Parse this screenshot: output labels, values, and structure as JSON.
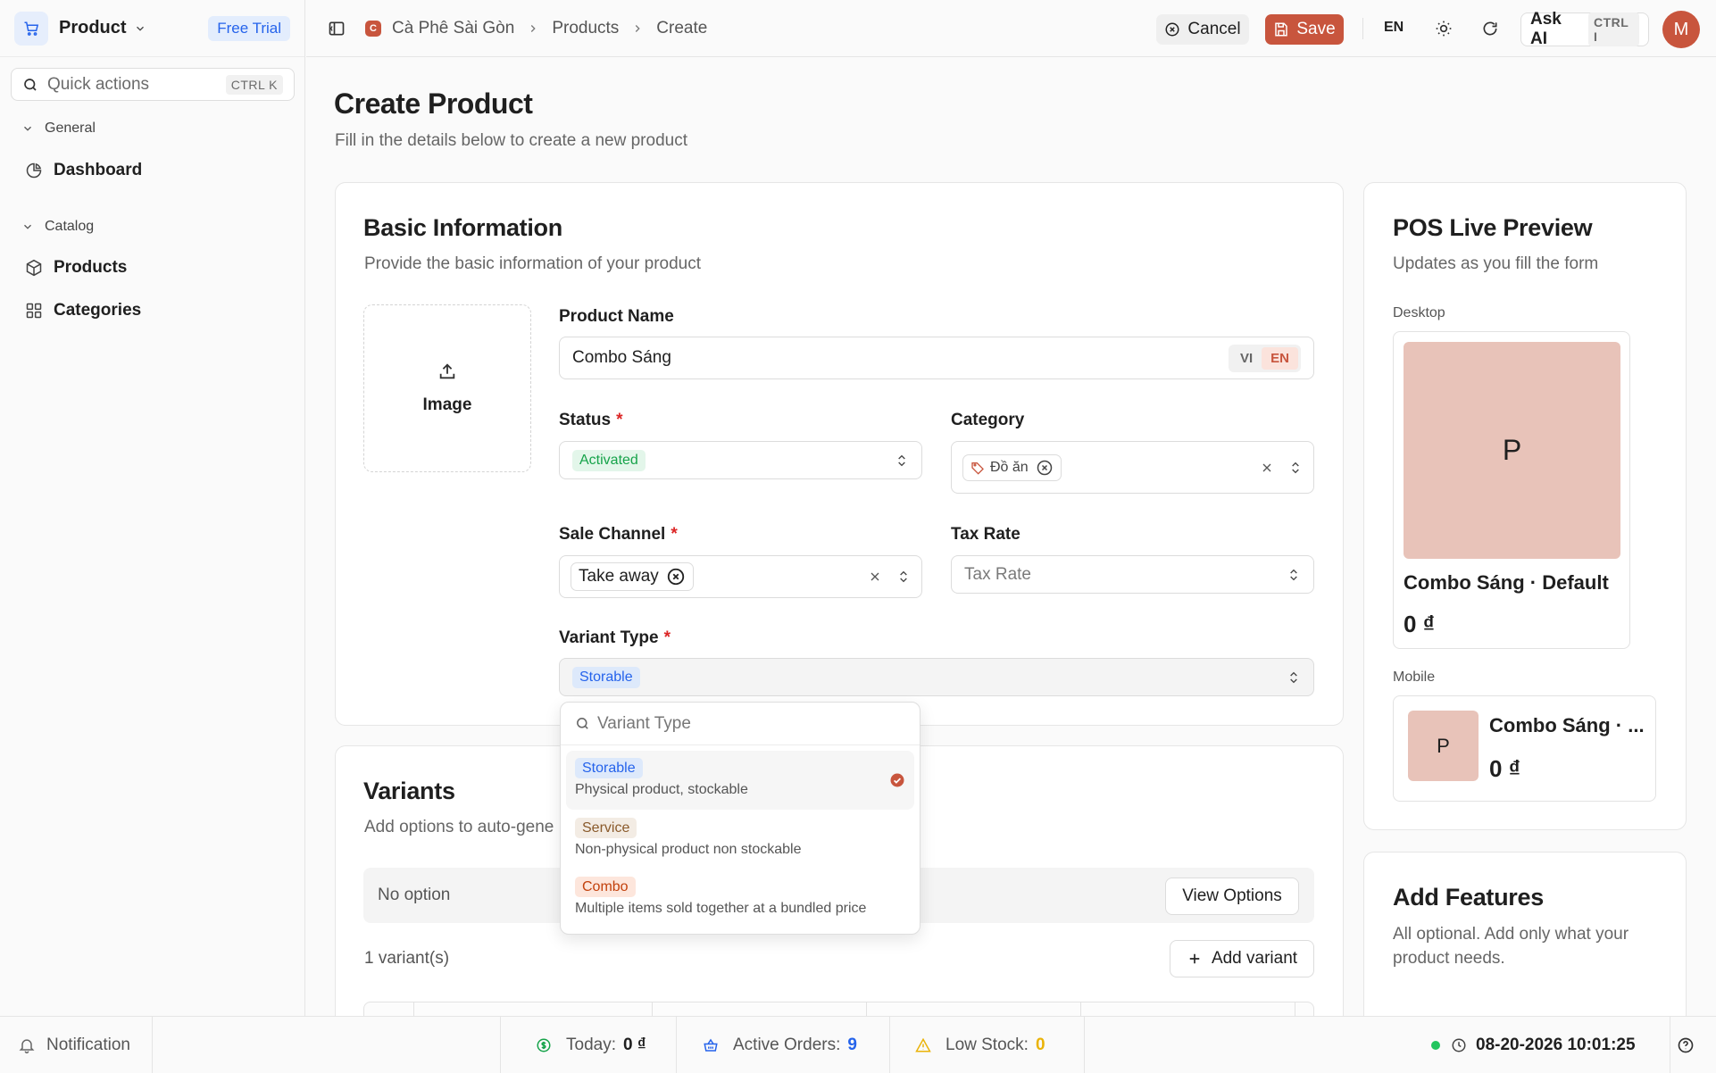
{
  "sidebar": {
    "app_name": "Product",
    "trial_badge": "Free Trial",
    "quick_actions": {
      "label": "Quick actions",
      "shortcut": "CTRL K"
    },
    "sections": [
      {
        "label": "General",
        "items": [
          {
            "label": "Dashboard",
            "icon": "pie-chart-icon"
          }
        ]
      },
      {
        "label": "Catalog",
        "items": [
          {
            "label": "Products",
            "icon": "box-icon"
          },
          {
            "label": "Categories",
            "icon": "grid-icon"
          }
        ]
      }
    ]
  },
  "topbar": {
    "breadcrumb": [
      "Cà Phê Sài Gòn",
      "Products",
      "Create"
    ],
    "store_initial": "C",
    "cancel_label": "Cancel",
    "save_label": "Save",
    "language": "EN",
    "ask_ai": {
      "label": "Ask AI",
      "shortcut": "CTRL I"
    },
    "avatar_initial": "M"
  },
  "page": {
    "title": "Create Product",
    "subtitle": "Fill in the details below to create a new product"
  },
  "basic_info": {
    "title": "Basic Information",
    "subtitle": "Provide the basic information of your product",
    "image_label": "Image",
    "product_name": {
      "label": "Product Name",
      "value": "Combo Sáng",
      "lang_options": [
        "VI",
        "EN"
      ],
      "active_lang": "EN"
    },
    "status": {
      "label": "Status",
      "value": "Activated",
      "required": "*"
    },
    "category": {
      "label": "Category",
      "tags": [
        "Đồ ăn"
      ]
    },
    "sale_channel": {
      "label": "Sale Channel",
      "required": "*",
      "tags": [
        "Take away"
      ]
    },
    "tax_rate": {
      "label": "Tax Rate",
      "placeholder": "Tax Rate"
    },
    "variant_type": {
      "label": "Variant Type",
      "required": "*",
      "value": "Storable"
    }
  },
  "variant_dropdown": {
    "search_placeholder": "Variant Type",
    "options": [
      {
        "label": "Storable",
        "description": "Physical product, stockable",
        "selected": true
      },
      {
        "label": "Service",
        "description": "Non-physical product non stockable",
        "selected": false
      },
      {
        "label": "Combo",
        "description": "Multiple items sold together at a bundled price",
        "selected": false
      }
    ]
  },
  "variants": {
    "title": "Variants",
    "subtitle": "Add options to auto-gene",
    "no_option": "No option",
    "view_options_label": "View Options",
    "count_text": "1 variant(s)",
    "add_variant_label": "Add variant"
  },
  "pos_preview": {
    "title": "POS Live Preview",
    "subtitle": "Updates as you fill the form",
    "desktop_label": "Desktop",
    "mobile_label": "Mobile",
    "initial": "P",
    "desktop_name": "Combo Sáng · Default",
    "mobile_name": "Combo Sáng · ...",
    "price": "0 ₫"
  },
  "add_features": {
    "title": "Add Features",
    "subtitle": "All optional. Add only what your product needs."
  },
  "statusbar": {
    "notification": "Notification",
    "today": {
      "label": "Today:",
      "value": "0 ₫"
    },
    "active_orders": {
      "label": "Active Orders:",
      "value": "9"
    },
    "low_stock": {
      "label": "Low Stock:",
      "value": "0"
    },
    "datetime": "08-20-2026 10:01:25"
  },
  "colors": {
    "accent": "#c8553d",
    "preview_tile": "#e8c3b9",
    "storable_badge": "#2563eb",
    "activated_badge": "#16a34a",
    "orders_value": "#2563eb",
    "low_stock_value": "#eab308",
    "online_dot": "#22c55e"
  }
}
